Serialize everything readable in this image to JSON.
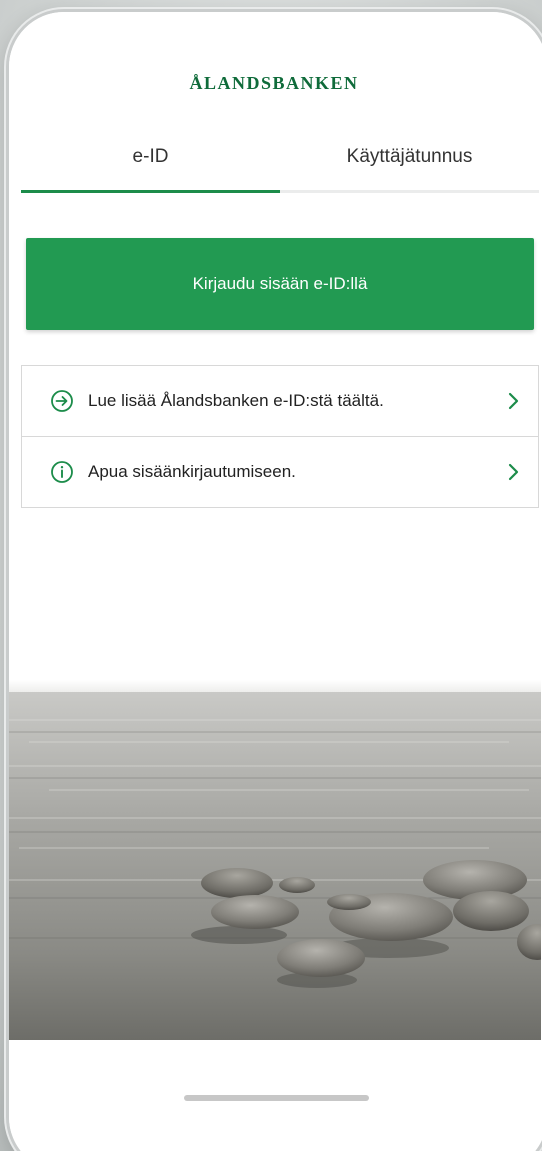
{
  "brand": {
    "logo_text": "ÅLANDSBANKEN",
    "accent_color": "#229a52",
    "logo_color": "#0f6b3a"
  },
  "tabs": [
    {
      "label": "e-ID",
      "active": true
    },
    {
      "label": "Käyttäjätunnus",
      "active": false
    }
  ],
  "primary_action": {
    "label": "Kirjaudu sisään e-ID:llä"
  },
  "links": [
    {
      "label": "Lue lisää Ålandsbanken e-ID:stä täältä.",
      "icon": "arrow-circle-right-icon"
    },
    {
      "label": "Apua sisäänkirjautumiseen.",
      "icon": "info-circle-icon"
    }
  ],
  "hero": {
    "icon": "lake-stones-photo"
  }
}
